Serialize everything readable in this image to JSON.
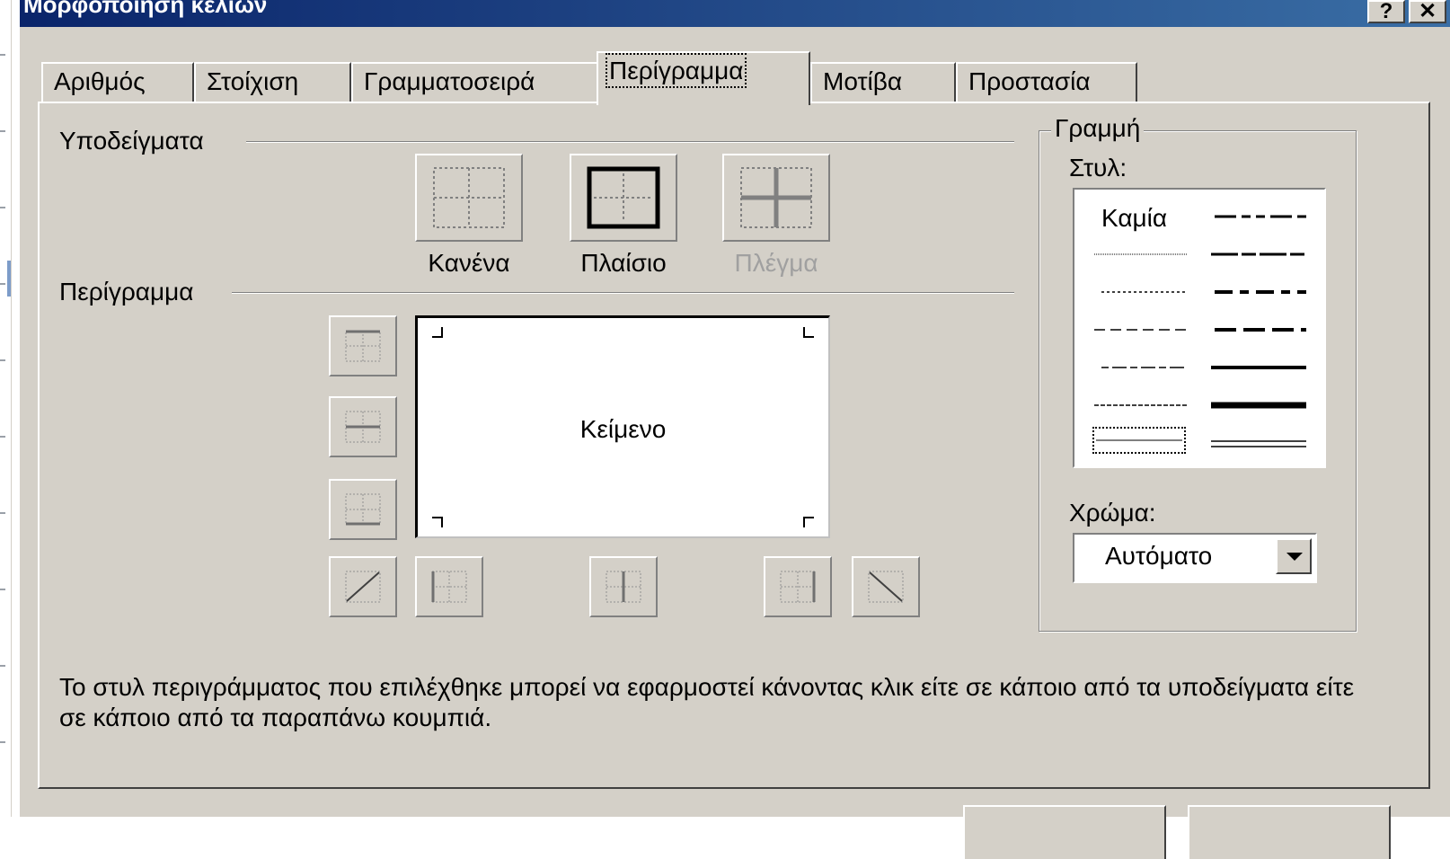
{
  "window": {
    "title": "Μορφοποίηση κελιών",
    "help_label": "?",
    "close_label": "✕"
  },
  "tabs": [
    {
      "label": "Αριθμός",
      "active": false
    },
    {
      "label": "Στοίχιση",
      "active": false
    },
    {
      "label": "Γραμματοσειρά",
      "active": false
    },
    {
      "label": "Περίγραμμα",
      "active": true
    },
    {
      "label": "Μοτίβα",
      "active": false
    },
    {
      "label": "Προστασία",
      "active": false
    }
  ],
  "presets": {
    "group_label": "Υποδείγματα",
    "none_label": "Κανένα",
    "outline_label": "Πλαίσιο",
    "inside_label": "Πλέγμα"
  },
  "border": {
    "group_label": "Περίγραμμα",
    "preview_text": "Κείμενο"
  },
  "line": {
    "group_label": "Γραμμή",
    "style_label": "Στυλ:",
    "none_style_label": "Καμία",
    "color_label": "Χρώμα:",
    "color_value": "Αυτόματο"
  },
  "info_text": "Το στυλ περιγράμματος που επιλέχθηκε μπορεί να εφαρμοστεί κάνοντας κλικ είτε σε κάποιο από τα υποδείγματα είτε σε κάποιο από τα παραπάνω κουμπιά.",
  "colors": {
    "face": "#d4d0c8",
    "titlebar_start": "#0a246a",
    "titlebar_end": "#3a6ea5",
    "disabled_text": "#a0a0a0"
  }
}
